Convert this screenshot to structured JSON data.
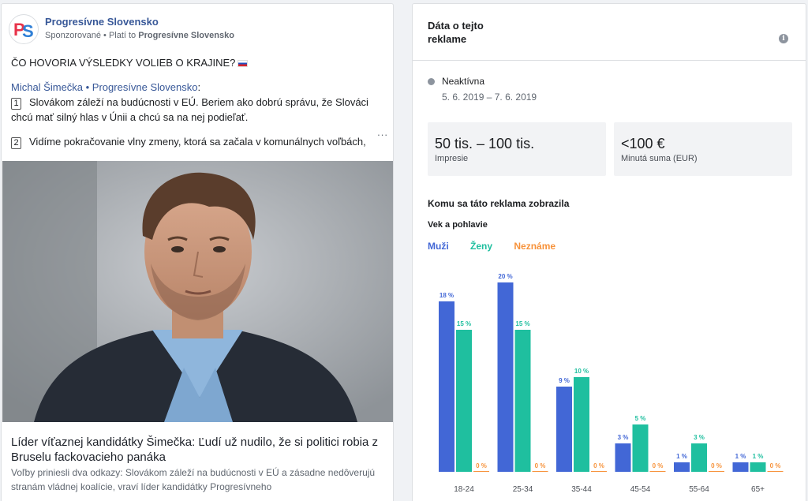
{
  "ad": {
    "page_name": "Progresívne Slovensko",
    "sponsored": "Sponzorované",
    "paid_by_prefix": "Platí to",
    "paid_by": "Progresívne Slovensko",
    "headline": "ČO HOVORIA VÝSLEDKY VOLIEB O KRAJINE?",
    "author": "Michal Šimečka • Progresívne Slovensko",
    "point1_num": "1",
    "point1": "Slovákom záleží na budúcnosti v EÚ. Beriem ako dobrú správu, že Slováci chcú mať silný hlas v Únii a chcú sa na nej podieľať.",
    "more": "...",
    "point2_num": "2",
    "point2": "Vidíme pokračovanie vlny zmeny, ktorá sa začala v komunálnych voľbách,",
    "link_title": "Líder víťaznej kandidátky Šimečka: Ľudí už nudilo, že si politici robia z Bruselu fackovacieho panáka",
    "link_desc": "Voľby priniesli dva odkazy: Slovákom záleží na budúcnosti v EÚ a zásadne nedôverujú stranám vládnej koalície, vraví líder kandidátky Progresívneho"
  },
  "panel": {
    "title": "Dáta o tejto reklame",
    "info_glyph": "i",
    "status": "Neaktívna",
    "dates": "5. 6. 2019 – 7. 6. 2019",
    "impressions_value": "50 tis. – 100 tis.",
    "impressions_label": "Impresie",
    "spend_value": "<100 €",
    "spend_label": "Minutá suma (EUR)",
    "audience_title": "Komu sa táto reklama zobrazila",
    "age_gender_title": "Vek a pohlavie"
  },
  "colors": {
    "men": "#4267d6",
    "women": "#1fbf9f",
    "unknown": "#f7923a"
  },
  "chart_data": {
    "type": "bar",
    "categories": [
      "18-24",
      "25-34",
      "35-44",
      "45-54",
      "55-64",
      "65+"
    ],
    "series": [
      {
        "name": "Muži",
        "values": [
          18,
          20,
          9,
          3,
          1,
          1
        ]
      },
      {
        "name": "Ženy",
        "values": [
          15,
          15,
          10,
          5,
          3,
          1
        ]
      },
      {
        "name": "Neznáme",
        "values": [
          0,
          0,
          0,
          0,
          0,
          0
        ]
      }
    ],
    "value_suffix": " %",
    "ylim": [
      0,
      20
    ]
  }
}
